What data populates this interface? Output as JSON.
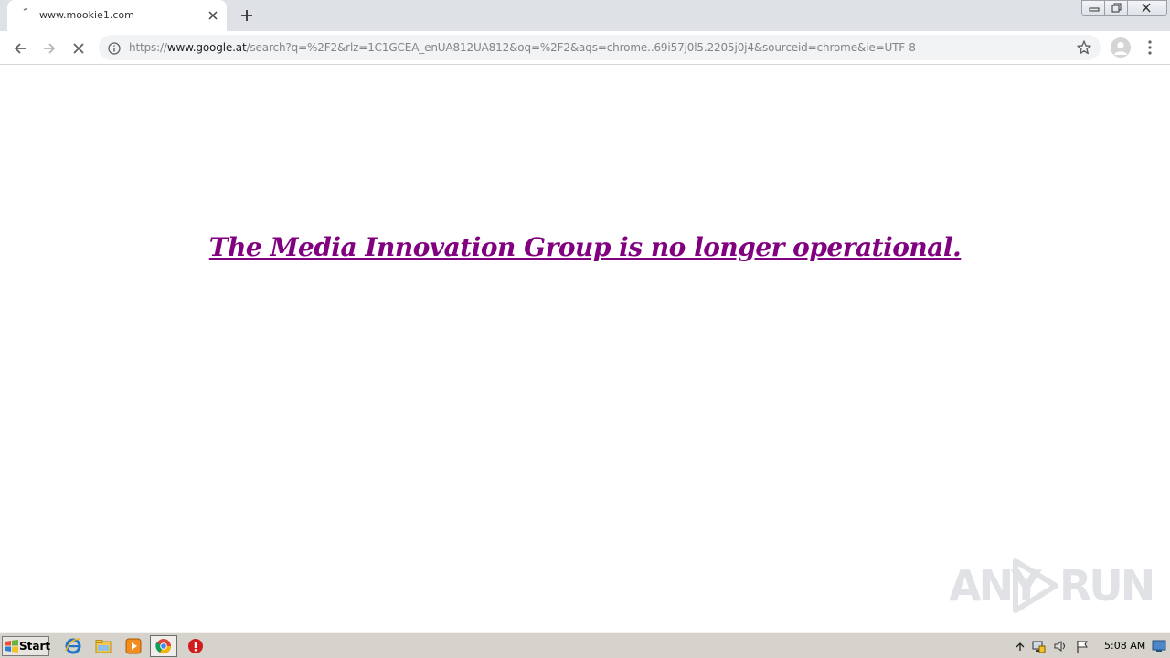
{
  "tab": {
    "title": "www.mookie1.com",
    "favicon": "loading-spinner-icon",
    "close": "×"
  },
  "newtab_label": "+",
  "omnibox": {
    "url_prefix": "https://",
    "url_host": "www.google.at",
    "url_path": "/search?q=%2F2&rlz=1C1GCEA_enUA812UA812&oq=%2F2&aqs=chrome..69i57j0l5.2205j0j4&sourceid=chrome&ie=UTF-8"
  },
  "page": {
    "message": "The Media Innovation Group is no longer operational.",
    "message_color": "#800080"
  },
  "watermark": {
    "left": "ANY",
    "right": "RUN"
  },
  "taskbar": {
    "start_label": "Start",
    "clock": "5:08 AM"
  },
  "colors": {
    "tab_strip": "#dee1e6",
    "omnibox": "#f1f3f4",
    "taskbar": "#d6d2cc"
  }
}
